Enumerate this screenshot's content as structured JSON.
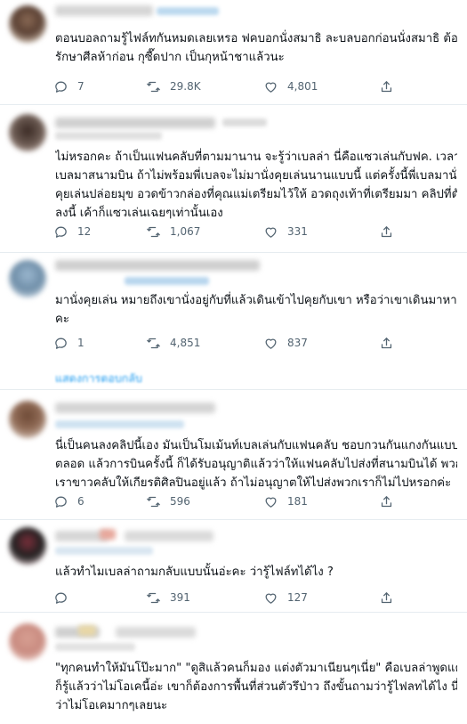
{
  "tweets": [
    {
      "lines": [
        "ตอนบอลถามรู้ไฟล์ทกันหมดเลยเหรอ ฟคบอกนั่งสมาธิ ละบลบอกก่อนนั่งสมาธิ ต้อง",
        "รักษาศีลห้าก่อน กุซี๊ดปาก เป็นกุหน้าชาแล้วนะ"
      ],
      "replies": "7",
      "retweets": "29.8K",
      "likes": "4,801"
    },
    {
      "lines": [
        "ไม่หรอกคะ ถ้าเป็นแฟนคลับที่ตามมานาน จะรู้ว่าเบลล่า นี่คือแซวเล่นกับฟค. เวลาพี่",
        "เบลมาสนามบิน ถ้าไม่พร้อมพี่เบลจะไม่มานั่งคุยเล่นนานแบบนี้ แต่ครั้งนี้พี่เบลมานั่ง",
        "คุยเล่นปล่อยมุข อวดข้าวกล่องที่คุณแม่เตรียมไว้ให้ อวดถุงเท้าที่เตรียมมา คลิปที่ตัด",
        "ลงนี้ เค้าก็แซวเล่นเฉยๆเท่านั้นเอง"
      ],
      "replies": "12",
      "retweets": "1,067",
      "likes": "331"
    },
    {
      "lines": [
        "มานั่งคุยเล่น หมายถึงเขานั่งอยู่กับที่แล้วเดินเข้าไปคุยกับเขา หรือว่าเขาเดินมาหาเอง",
        "คะ"
      ],
      "replies": "1",
      "retweets": "4,851",
      "likes": "837"
    },
    {
      "lines": [
        "นี่เป็นคนลงคลิปนี้เอง มันเป็นโมเม้นท์เบลเล่นกับแฟนคลับ ชอบกวนกันแกงกันแบบนี้",
        "ตลอด แล้วการบินครั้งนี้ ก็ได้รับอนุญาติแล้วว่าให้แฟนคลับไปส่งที่สนามบินได้ พวก",
        "เราขาวคลับให้เกียรติศิลปินอยู่แล้ว ถ้าไม่อนุญาตให้ไปส่งพวกเราก็ไม่ไปหรอกค่ะ"
      ],
      "replies": "6",
      "retweets": "596",
      "likes": "181"
    },
    {
      "lines": [
        "แล้วทำไมเบลล่าถามกลับแบบนั้นอ่ะคะ ว่ารู้ไฟล์ทได้ไง ?"
      ],
      "replies": "",
      "retweets": "391",
      "likes": "127"
    },
    {
      "lines": [
        "\"ทุกคนทำให้มันโป๊ะมาก\" \"ดูสิแล้วคนก็มอง แต่งตัวมาเนียนๆเนี่ย\" คือเบลล่าพูดแค่นี้",
        "ก็รู้แล้วว่าไม่โอเคนี้อ่ะ เขาก็ต้องการพื้นที่ส่วนตัวรึป่าว ถึงขั้นถามว่ารู้ไฟลทได้ไง นี่",
        "ว่าไม่โอเคมากๆเลยนะ"
      ]
    }
  ],
  "show_replies_label": "แสดงการตอบกลับ",
  "colors": {
    "icon": "#536471",
    "text": "#0f1419",
    "link": "#1d9bf0",
    "divider": "#e6ecf0"
  },
  "icons": [
    "reply-icon",
    "retweet-icon",
    "like-icon",
    "share-icon"
  ]
}
